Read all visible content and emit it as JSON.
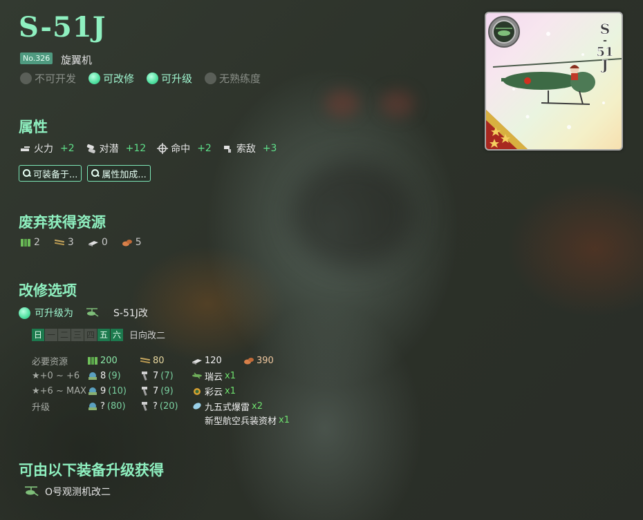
{
  "equipment": {
    "name": "S-51J",
    "number": "No.326",
    "type": "旋翼机",
    "card_name_vertical": "S-51J"
  },
  "flags": [
    {
      "label": "不可开发",
      "on": false
    },
    {
      "label": "可改修",
      "on": true
    },
    {
      "label": "可升级",
      "on": true
    },
    {
      "label": "无熟练度",
      "on": false
    }
  ],
  "attributes": {
    "title": "属性",
    "stats": [
      {
        "icon": "firepower-icon",
        "label": "火力",
        "value": "+2"
      },
      {
        "icon": "asw-icon",
        "label": "对潜",
        "value": "+12"
      },
      {
        "icon": "accuracy-icon",
        "label": "命中",
        "value": "+2"
      },
      {
        "icon": "los-icon",
        "label": "索敌",
        "value": "+3"
      }
    ],
    "buttons": [
      "可装备于...",
      "属性加成..."
    ]
  },
  "scrap": {
    "title": "废弃获得资源",
    "resources": [
      {
        "icon": "fuel-icon",
        "value": "2"
      },
      {
        "icon": "ammo-icon",
        "value": "3"
      },
      {
        "icon": "steel-icon",
        "value": "0"
      },
      {
        "icon": "bauxite-icon",
        "value": "5"
      }
    ]
  },
  "improvement": {
    "title": "改修选项",
    "upgrade_label": "可升级为",
    "upgrade_target": "S-51J改",
    "days": [
      {
        "label": "日",
        "on": true
      },
      {
        "label": "一",
        "on": false
      },
      {
        "label": "二",
        "on": false
      },
      {
        "label": "三",
        "on": false
      },
      {
        "label": "四",
        "on": false
      },
      {
        "label": "五",
        "on": true
      },
      {
        "label": "六",
        "on": true
      }
    ],
    "assistant": "日向改二",
    "requirements": {
      "label": "必要资源",
      "fuel": "200",
      "ammo": "80",
      "steel": "120",
      "bauxite": "390"
    },
    "stages": [
      {
        "label": "★+0 ~ +6",
        "devmat": "8",
        "devmat_sure": "(9)",
        "screw": "7",
        "screw_sure": "(7)",
        "item_name": "瑞云",
        "item_count": "x1"
      },
      {
        "label": "★+6 ~ MAX",
        "devmat": "9",
        "devmat_sure": "(10)",
        "screw": "7",
        "screw_sure": "(9)",
        "item_name": "彩云",
        "item_count": "x1"
      },
      {
        "label": "升级",
        "devmat": "?",
        "devmat_sure": "(80)",
        "screw": "?",
        "screw_sure": "(20)",
        "item_name": "九五式爆雷",
        "item_count": "x2",
        "item2_name": "新型航空兵装资材",
        "item2_count": "x1"
      }
    ]
  },
  "upgrade_from": {
    "title": "可由以下装备升级获得",
    "items": [
      "O号观测机改二"
    ]
  },
  "colors": {
    "accent": "#8ff0c0",
    "positive": "#5fe08a",
    "day_on": "#1d7a4e"
  }
}
